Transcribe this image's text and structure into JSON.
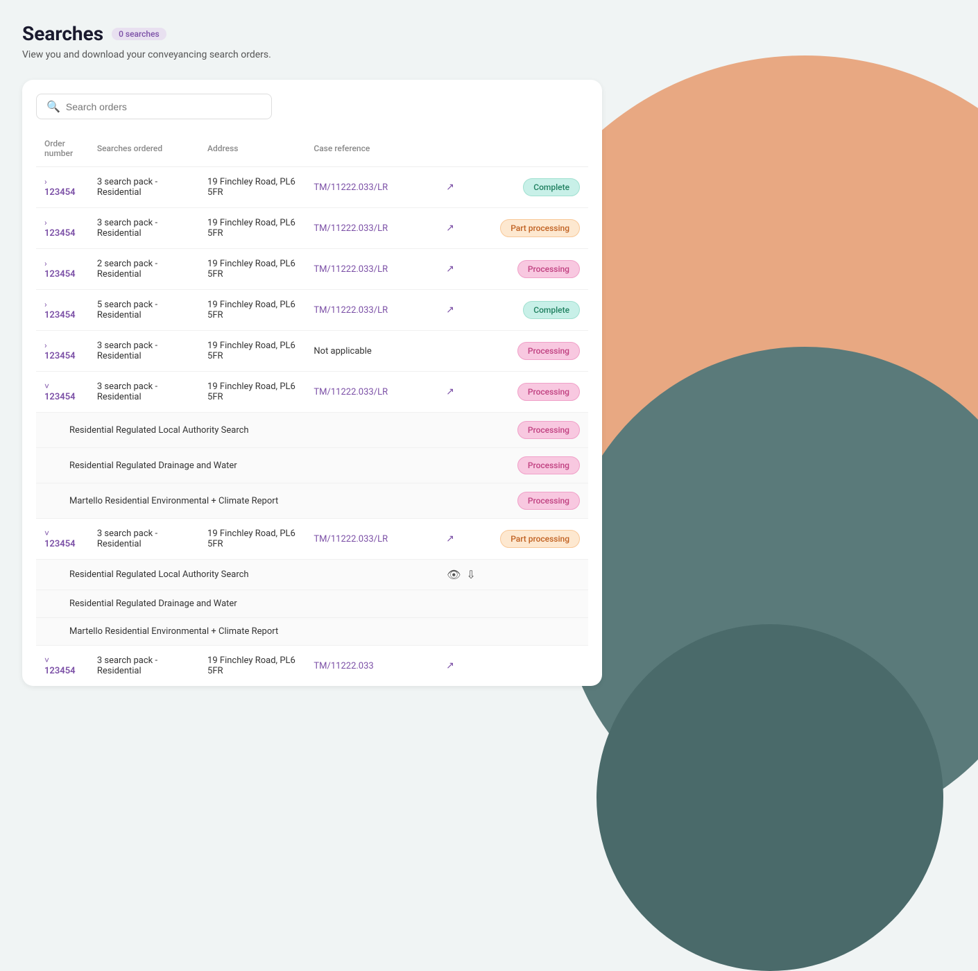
{
  "page": {
    "title": "Searches",
    "badge": "0 searches",
    "subtitle": "View you and download your conveyancing search orders."
  },
  "search": {
    "placeholder": "Search orders"
  },
  "table": {
    "headers": [
      "Order number",
      "Searches ordered",
      "Address",
      "Case reference"
    ],
    "rows": [
      {
        "id": "row1",
        "type": "order",
        "expanded": false,
        "chevron": "›",
        "order_number": "123454",
        "searches": "3 search pack - Residential",
        "address": "19 Finchley Road, PL6 5FR",
        "case_ref": "TM/11222.033/LR",
        "has_case_link": true,
        "status": "Complete",
        "status_type": "complete"
      },
      {
        "id": "row2",
        "type": "order",
        "expanded": false,
        "chevron": "›",
        "order_number": "123454",
        "searches": "3 search pack - Residential",
        "address": "19 Finchley Road, PL6 5FR",
        "case_ref": "TM/11222.033/LR",
        "has_case_link": true,
        "status": "Part processing",
        "status_type": "part"
      },
      {
        "id": "row3",
        "type": "order",
        "expanded": false,
        "chevron": "›",
        "order_number": "123454",
        "searches": "2 search pack - Residential",
        "address": "19 Finchley Road, PL6 5FR",
        "case_ref": "TM/11222.033/LR",
        "has_case_link": true,
        "status": "Processing",
        "status_type": "processing"
      },
      {
        "id": "row4",
        "type": "order",
        "expanded": false,
        "chevron": "›",
        "order_number": "123454",
        "searches": "5 search pack - Residential",
        "address": "19 Finchley Road, PL6 5FR",
        "case_ref": "TM/11222.033/LR",
        "has_case_link": true,
        "status": "Complete",
        "status_type": "complete"
      },
      {
        "id": "row5",
        "type": "order",
        "expanded": false,
        "chevron": "›",
        "order_number": "123454",
        "searches": "3 search pack - Residential",
        "address": "19 Finchley Road, PL6 5FR",
        "case_ref": "Not applicable",
        "has_case_link": false,
        "status": "Processing",
        "status_type": "processing"
      },
      {
        "id": "row6",
        "type": "order",
        "expanded": true,
        "chevron": "˅",
        "order_number": "123454",
        "searches": "3 search pack - Residential",
        "address": "19 Finchley Road, PL6 5FR",
        "case_ref": "TM/11222.033/LR",
        "has_case_link": true,
        "status": "Processing",
        "status_type": "processing",
        "sub_items": [
          {
            "name": "Residential Regulated Local Authority Search",
            "status": "Processing",
            "status_type": "processing"
          },
          {
            "name": "Residential Regulated Drainage and Water",
            "status": "Processing",
            "status_type": "processing"
          },
          {
            "name": "Martello Residential Environmental + Climate Report",
            "status": "Processing",
            "status_type": "processing"
          }
        ]
      },
      {
        "id": "row7",
        "type": "order",
        "expanded": true,
        "chevron": "˅",
        "order_number": "123454",
        "searches": "3 search pack - Residential",
        "address": "19 Finchley Road, PL6 5FR",
        "case_ref": "TM/11222.033/LR",
        "has_case_link": true,
        "status": "Part processing",
        "status_type": "part",
        "sub_items": [
          {
            "name": "Residential Regulated Local Authority Search",
            "status": null,
            "has_actions": true
          },
          {
            "name": "Residential Regulated Drainage and Water",
            "status": null
          },
          {
            "name": "Martello Residential Environmental + Climate Report",
            "status": null
          }
        ]
      },
      {
        "id": "row8",
        "type": "order",
        "expanded": true,
        "chevron": "˅",
        "order_number": "123454",
        "searches": "3 search pack - Residential",
        "address": "19 Finchley Road, PL6 5FR",
        "case_ref": "TM/11222.033",
        "has_case_link": true,
        "status": null,
        "status_type": null
      }
    ]
  }
}
